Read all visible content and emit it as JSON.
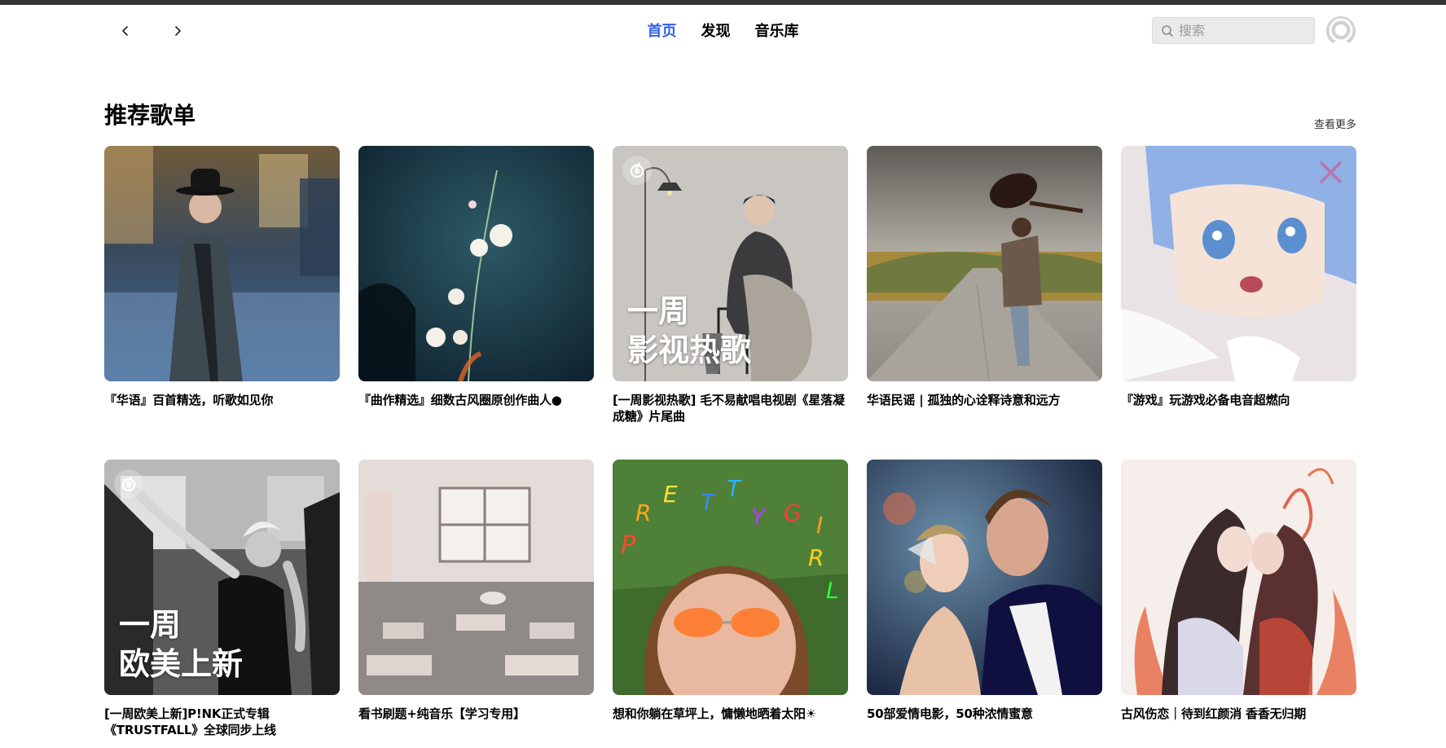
{
  "nav": {
    "links": [
      "首页",
      "发现",
      "音乐库"
    ],
    "active_index": 0,
    "search_placeholder": "搜索"
  },
  "section": {
    "title": "推荐歌单",
    "see_more": "查看更多"
  },
  "playlists": [
    {
      "title": "『华语』百首精选，听歌如见你",
      "cover": "man-in-hat-street"
    },
    {
      "title": "『曲作精选』细数古风圈原创作曲人●",
      "cover": "white-flowers-dark-blue"
    },
    {
      "title": "[一周影视热歌] 毛不易献唱电视剧《星落凝成糖》片尾曲",
      "cover": "man-knitting-lamp",
      "badge": true,
      "cover_text": [
        "一周",
        "影视热歌"
      ]
    },
    {
      "title": "华语民谣 | 孤独的心诠释诗意和远方",
      "cover": "guitarist-country-road"
    },
    {
      "title": "『游戏』玩游戏必备电音超燃向",
      "cover": "anime-blue-hair-girl"
    },
    {
      "title": "[一周欧美上新]P!NK正式专辑《TRUSTFALL》全球同步上线",
      "cover": "bw-singer-train",
      "badge": true,
      "cover_text": [
        "一周",
        "欧美上新"
      ]
    },
    {
      "title": "看书刷题+纯音乐【学习专用】",
      "cover": "empty-classroom"
    },
    {
      "title": "想和你躺在草坪上，慵懒地晒着太阳☀",
      "cover": "pretty-girl-grass",
      "cover_letters": "PRETTYGIRL"
    },
    {
      "title": "50部爱情电影，50种浓情蜜意",
      "cover": "couple-gatsby"
    },
    {
      "title": "古风伤恋｜待到红颜消 香香无归期",
      "cover": "ancient-lovers-flames"
    }
  ]
}
